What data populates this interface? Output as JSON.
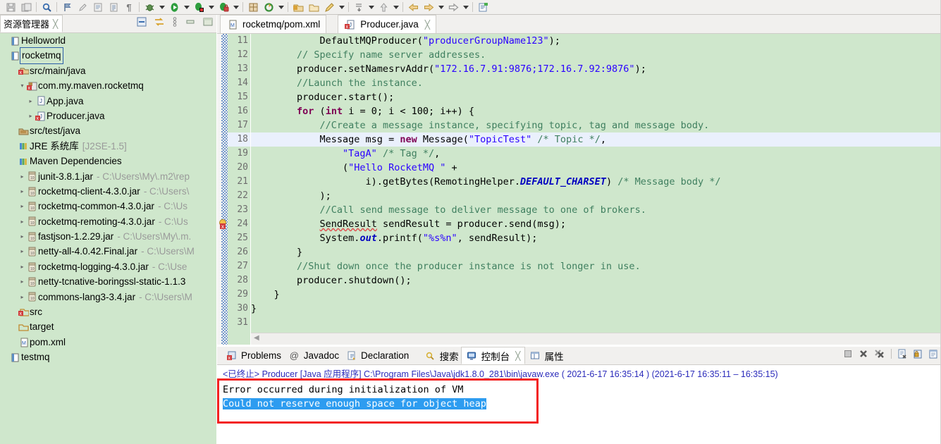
{
  "toolbar": {
    "groups": [
      {
        "items": [
          {
            "icon": "save-icon",
            "glyph": "💾"
          },
          {
            "icon": "save-all-icon",
            "glyph": "🗐"
          }
        ]
      },
      {
        "items": [
          {
            "icon": "search-icon",
            "glyph": "🔍"
          }
        ]
      },
      {
        "items": [
          {
            "icon": "next-annotation-icon",
            "glyph": "⚑"
          },
          {
            "icon": "last-edit-icon",
            "glyph": "✎"
          },
          {
            "icon": "open-type-icon",
            "glyph": "🗒"
          },
          {
            "icon": "open-task-icon",
            "glyph": "📋"
          },
          {
            "icon": "pilcrow-icon",
            "glyph": "¶"
          }
        ]
      },
      {
        "items": [
          {
            "icon": "debug-icon",
            "glyph": "🐞",
            "dropdown": true
          },
          {
            "icon": "run-icon",
            "glyph": "▶",
            "dropdown": true
          },
          {
            "icon": "run-external-tools-icon",
            "glyph": "🛠",
            "dropdown": true
          },
          {
            "icon": "coverage-icon",
            "glyph": "🔒",
            "dropdown": true
          }
        ]
      },
      {
        "items": [
          {
            "icon": "new-java-package-icon",
            "glyph": "📦"
          },
          {
            "icon": "refresh-icon",
            "glyph": "⟳",
            "dropdown": true
          }
        ]
      },
      {
        "items": [
          {
            "icon": "open-folder-icon",
            "glyph": "📂"
          },
          {
            "icon": "open-folder-2-icon",
            "glyph": "🗂"
          },
          {
            "icon": "marker-icon",
            "glyph": "🖊",
            "dropdown": true
          }
        ]
      },
      {
        "items": [
          {
            "icon": "step-icon",
            "glyph": "⤓",
            "dropdown": true
          },
          {
            "icon": "step-up-icon",
            "glyph": "⇧",
            "dropdown": true
          }
        ]
      },
      {
        "items": [
          {
            "icon": "back-icon",
            "glyph": "⇦"
          },
          {
            "icon": "forward-icon",
            "glyph": "⇨",
            "dropdown": true
          },
          {
            "icon": "next-icon",
            "glyph": "⇨",
            "dropdown": true
          }
        ]
      },
      {
        "items": [
          {
            "icon": "new-editor-icon",
            "glyph": "📝"
          }
        ]
      }
    ]
  },
  "explorer": {
    "tab_label": "资源管理器",
    "tab_close": "✄",
    "tools": [
      {
        "name": "collapse-all-icon",
        "glyph": "▤"
      },
      {
        "name": "link-with-editor-icon",
        "glyph": "⇄"
      },
      {
        "name": "view-menu-icon",
        "glyph": "⋮"
      },
      {
        "name": "minimize-icon",
        "glyph": "▭"
      },
      {
        "name": "maximize-icon",
        "glyph": "▣"
      }
    ],
    "tree": [
      {
        "indent": 0,
        "arrow": "",
        "icon": "project-icon",
        "label": "Helloworld",
        "path": "",
        "selected": false
      },
      {
        "indent": 0,
        "arrow": "",
        "icon": "project-icon",
        "label": "rocketmq",
        "path": "",
        "selected": true
      },
      {
        "indent": 1,
        "arrow": "",
        "icon": "source-folder-error-icon",
        "label": "src/main/java",
        "path": "",
        "selected": false
      },
      {
        "indent": 2,
        "arrow": "▾",
        "icon": "package-error-icon",
        "label": "com.my.maven.rocketmq",
        "path": "",
        "selected": false
      },
      {
        "indent": 3,
        "arrow": "▸",
        "icon": "java-file-icon",
        "label": "App.java",
        "path": "",
        "selected": false
      },
      {
        "indent": 3,
        "arrow": "▸",
        "icon": "java-file-error-icon",
        "label": "Producer.java",
        "path": "",
        "selected": false
      },
      {
        "indent": 1,
        "arrow": "",
        "icon": "source-folder-icon",
        "label": "src/test/java",
        "path": "",
        "selected": false
      },
      {
        "indent": 1,
        "arrow": "",
        "icon": "library-icon",
        "label": "JRE 系统库",
        "path": "[J2SE-1.5]",
        "selected": false
      },
      {
        "indent": 1,
        "arrow": "",
        "icon": "library-icon",
        "label": "Maven Dependencies",
        "path": "",
        "selected": false
      },
      {
        "indent": 2,
        "arrow": "▸",
        "icon": "jar-icon",
        "label": "junit-3.8.1.jar",
        "path": "- C:\\Users\\My\\.m2\\rep",
        "selected": false
      },
      {
        "indent": 2,
        "arrow": "▸",
        "icon": "jar-icon",
        "label": "rocketmq-client-4.3.0.jar",
        "path": "- C:\\Users\\",
        "selected": false
      },
      {
        "indent": 2,
        "arrow": "▸",
        "icon": "jar-icon",
        "label": "rocketmq-common-4.3.0.jar",
        "path": "- C:\\Us",
        "selected": false
      },
      {
        "indent": 2,
        "arrow": "▸",
        "icon": "jar-icon",
        "label": "rocketmq-remoting-4.3.0.jar",
        "path": "- C:\\Us",
        "selected": false
      },
      {
        "indent": 2,
        "arrow": "▸",
        "icon": "jar-icon",
        "label": "fastjson-1.2.29.jar",
        "path": "- C:\\Users\\My\\.m.",
        "selected": false
      },
      {
        "indent": 2,
        "arrow": "▸",
        "icon": "jar-icon",
        "label": "netty-all-4.0.42.Final.jar",
        "path": "- C:\\Users\\M",
        "selected": false
      },
      {
        "indent": 2,
        "arrow": "▸",
        "icon": "jar-icon",
        "label": "rocketmq-logging-4.3.0.jar",
        "path": "- C:\\Use",
        "selected": false
      },
      {
        "indent": 2,
        "arrow": "▸",
        "icon": "jar-icon",
        "label": "netty-tcnative-boringssl-static-1.1.3",
        "path": "",
        "selected": false
      },
      {
        "indent": 2,
        "arrow": "▸",
        "icon": "jar-icon",
        "label": "commons-lang3-3.4.jar",
        "path": "- C:\\Users\\M",
        "selected": false
      },
      {
        "indent": 1,
        "arrow": "",
        "icon": "folder-error-icon",
        "label": "src",
        "path": "",
        "selected": false
      },
      {
        "indent": 1,
        "arrow": "",
        "icon": "folder-icon",
        "label": "target",
        "path": "",
        "selected": false
      },
      {
        "indent": 1,
        "arrow": "",
        "icon": "xml-file-icon",
        "label": "pom.xml",
        "path": "",
        "selected": false
      },
      {
        "indent": 0,
        "arrow": "",
        "icon": "project-icon",
        "label": "testmq",
        "path": "",
        "selected": false
      }
    ]
  },
  "editor": {
    "tabs": [
      {
        "label": "rocketmq/pom.xml",
        "icon": "xml-file-icon",
        "active": false,
        "closable": false
      },
      {
        "label": "Producer.java",
        "icon": "java-file-error-icon",
        "active": true,
        "closable": true
      }
    ],
    "first_line_number": 11,
    "highlighted_line": 18,
    "error_marker_line": 24,
    "lines": [
      {
        "n": 11,
        "segs": [
          {
            "t": "            DefaultMQProducer(",
            "c": "pl"
          },
          {
            "t": "\"producerGroupName123\"",
            "c": "str"
          },
          {
            "t": ");",
            "c": "pl"
          }
        ]
      },
      {
        "n": 12,
        "segs": [
          {
            "t": "        ",
            "c": "pl"
          },
          {
            "t": "// Specify name server addresses.",
            "c": "cmt"
          }
        ]
      },
      {
        "n": 13,
        "segs": [
          {
            "t": "        producer.setNamesrvAddr(",
            "c": "pl"
          },
          {
            "t": "\"172.16.7.91:9876;172.16.7.92:9876\"",
            "c": "str"
          },
          {
            "t": ");",
            "c": "pl"
          }
        ]
      },
      {
        "n": 14,
        "segs": [
          {
            "t": "        ",
            "c": "pl"
          },
          {
            "t": "//Launch the instance.",
            "c": "cmt"
          }
        ]
      },
      {
        "n": 15,
        "segs": [
          {
            "t": "        producer.start();",
            "c": "pl"
          }
        ]
      },
      {
        "n": 16,
        "segs": [
          {
            "t": "        ",
            "c": "pl"
          },
          {
            "t": "for",
            "c": "kw"
          },
          {
            "t": " (",
            "c": "pl"
          },
          {
            "t": "int",
            "c": "kw"
          },
          {
            "t": " i = 0; i < 100; i++) {",
            "c": "pl"
          }
        ]
      },
      {
        "n": 17,
        "segs": [
          {
            "t": "            ",
            "c": "pl"
          },
          {
            "t": "//Create a message instance, specifying topic, tag and message body.",
            "c": "cmt"
          }
        ]
      },
      {
        "n": 18,
        "segs": [
          {
            "t": "            Message msg = ",
            "c": "pl"
          },
          {
            "t": "new",
            "c": "kw"
          },
          {
            "t": " Message(",
            "c": "pl"
          },
          {
            "t": "\"TopicTest\"",
            "c": "str"
          },
          {
            "t": " ",
            "c": "pl"
          },
          {
            "t": "/* Topic */",
            "c": "cmt"
          },
          {
            "t": ",",
            "c": "pl"
          }
        ]
      },
      {
        "n": 19,
        "segs": [
          {
            "t": "                ",
            "c": "pl"
          },
          {
            "t": "\"TagA\"",
            "c": "str"
          },
          {
            "t": " ",
            "c": "pl"
          },
          {
            "t": "/* Tag */",
            "c": "cmt"
          },
          {
            "t": ",",
            "c": "pl"
          }
        ]
      },
      {
        "n": 20,
        "segs": [
          {
            "t": "                (",
            "c": "pl"
          },
          {
            "t": "\"Hello RocketMQ \"",
            "c": "str"
          },
          {
            "t": " +",
            "c": "pl"
          }
        ]
      },
      {
        "n": 21,
        "segs": [
          {
            "t": "                    i).getBytes(RemotingHelper.",
            "c": "pl"
          },
          {
            "t": "DEFAULT_CHARSET",
            "c": "fld"
          },
          {
            "t": ") ",
            "c": "pl"
          },
          {
            "t": "/* Message body */",
            "c": "cmt"
          }
        ]
      },
      {
        "n": 22,
        "segs": [
          {
            "t": "            );",
            "c": "pl"
          }
        ]
      },
      {
        "n": 23,
        "segs": [
          {
            "t": "            ",
            "c": "pl"
          },
          {
            "t": "//Call send message to deliver message to one of brokers.",
            "c": "cmt"
          }
        ]
      },
      {
        "n": 24,
        "segs": [
          {
            "t": "            ",
            "c": "pl"
          },
          {
            "t": "SendResult",
            "c": "err"
          },
          {
            "t": " sendResult = producer.send(msg);",
            "c": "pl"
          }
        ]
      },
      {
        "n": 25,
        "segs": [
          {
            "t": "            System.",
            "c": "pl"
          },
          {
            "t": "out",
            "c": "fld"
          },
          {
            "t": ".printf(",
            "c": "pl"
          },
          {
            "t": "\"%s%n\"",
            "c": "str"
          },
          {
            "t": ", sendResult);",
            "c": "pl"
          }
        ]
      },
      {
        "n": 26,
        "segs": [
          {
            "t": "        }",
            "c": "pl"
          }
        ]
      },
      {
        "n": 27,
        "segs": [
          {
            "t": "        ",
            "c": "pl"
          },
          {
            "t": "//Shut down once the producer instance is not longer in use.",
            "c": "cmt"
          }
        ]
      },
      {
        "n": 28,
        "segs": [
          {
            "t": "        producer.shutdown();",
            "c": "pl"
          }
        ]
      },
      {
        "n": 29,
        "segs": [
          {
            "t": "    }",
            "c": "pl"
          }
        ]
      },
      {
        "n": 30,
        "segs": [
          {
            "t": "}",
            "c": "pl"
          }
        ]
      },
      {
        "n": 31,
        "segs": [
          {
            "t": "",
            "c": "pl"
          }
        ]
      }
    ]
  },
  "console": {
    "tabs": [
      {
        "label": "Problems",
        "icon": "problems-icon",
        "active": false,
        "closable": false
      },
      {
        "label": "Javadoc",
        "icon": "javadoc-icon",
        "active": false,
        "closable": false
      },
      {
        "label": "Declaration",
        "icon": "declaration-icon",
        "active": false,
        "closable": false
      },
      {
        "label": "搜索",
        "icon": "search-icon",
        "active": false,
        "closable": false
      },
      {
        "label": "控制台",
        "icon": "console-icon",
        "active": true,
        "closable": true
      },
      {
        "label": "属性",
        "icon": "properties-icon",
        "active": false,
        "closable": false
      }
    ],
    "tools": [
      {
        "name": "terminate-icon",
        "glyph": "■"
      },
      {
        "name": "remove-launch-icon",
        "glyph": "✖"
      },
      {
        "name": "remove-all-terminated-icon",
        "glyph": "✖"
      },
      {
        "name": "clear-console-icon",
        "glyph": "🗋"
      },
      {
        "name": "scroll-lock-icon",
        "glyph": "🔒"
      },
      {
        "name": "pin-console-icon",
        "glyph": "▤"
      }
    ],
    "header": "<已终止> Producer [Java 应用程序] C:\\Program Files\\Java\\jdk1.8.0_281\\bin\\javaw.exe ( 2021-6-17 16:35:14 )  (2021-6-17 16:35:11 – 16:35:15)",
    "output_lines": [
      {
        "text": "Error occurred during initialization of VM",
        "selected": false
      },
      {
        "text": "Could not reserve enough space for object heap",
        "selected": true
      }
    ],
    "highlight_box_color": "#f32121",
    "selection_color": "#2d9cf0"
  },
  "colors": {
    "editor_background": "#cfe7cc",
    "tree_background": "#cfe7cc",
    "chrome": "#f1f0ee",
    "keyword": "#7f0055",
    "string": "#2a00ff",
    "comment": "#3f7f5f",
    "static_field": "#0000c0",
    "line_highlight": "#eaf0fc"
  }
}
